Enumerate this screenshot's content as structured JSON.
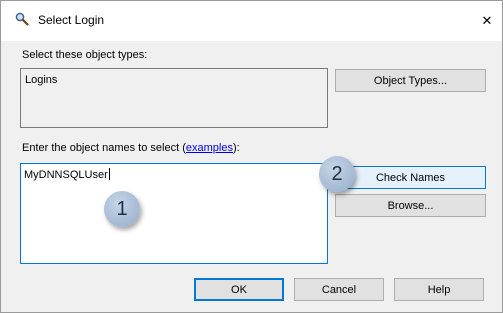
{
  "window": {
    "title": "Select Login",
    "close_glyph": "✕"
  },
  "object_types": {
    "label": "Select these object types:",
    "value": "Logins",
    "button_label": "Object Types..."
  },
  "names": {
    "label_prefix": "Enter the object names to select (",
    "label_link": "examples",
    "label_suffix": "):",
    "value": "MyDNNSQLUser",
    "check_names_label": "Check Names",
    "browse_label": "Browse..."
  },
  "footer": {
    "ok_label": "OK",
    "cancel_label": "Cancel",
    "help_label": "Help"
  },
  "callouts": {
    "one": "1",
    "two": "2"
  },
  "colors": {
    "accent": "#0078d7",
    "link": "#0000ee",
    "callout": "#a8bcd6"
  }
}
